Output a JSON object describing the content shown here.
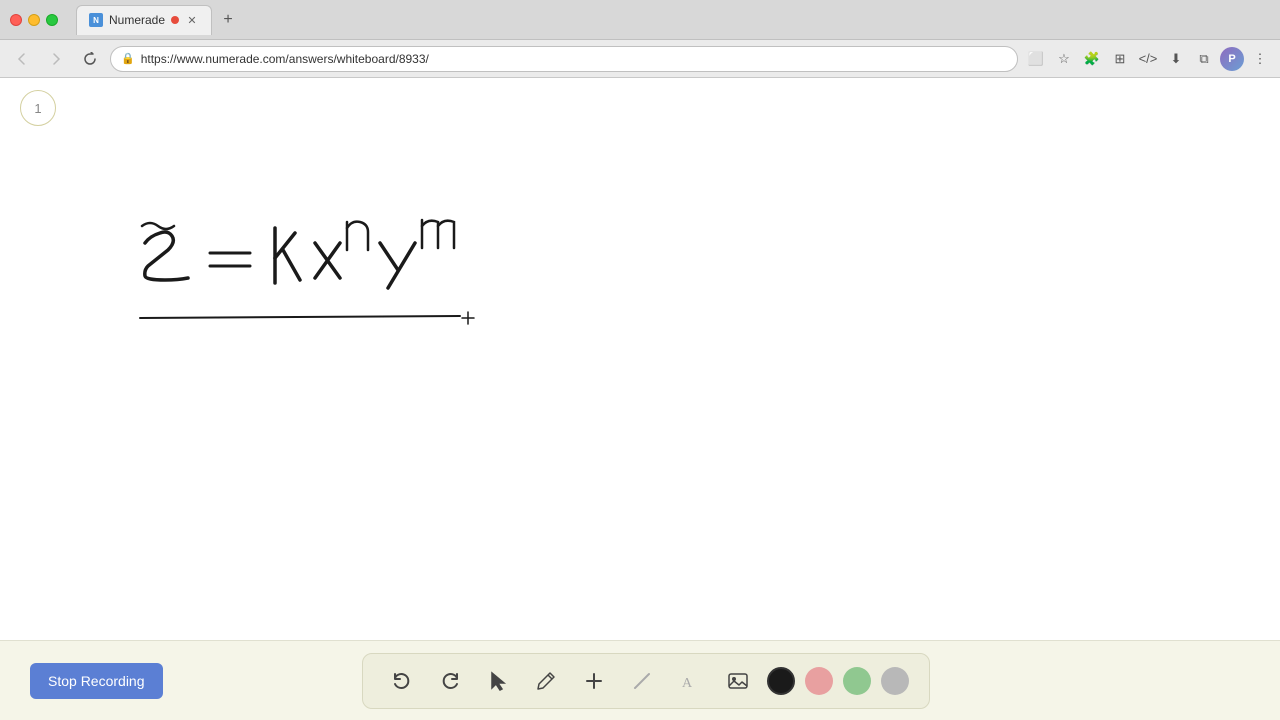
{
  "browser": {
    "tab": {
      "label": "Numerade",
      "favicon_text": "N",
      "has_recording_dot": true
    },
    "url": "https://www.numerade.com/answers/whiteboard/8933/",
    "nav": {
      "back": "←",
      "forward": "→",
      "refresh": "↻"
    }
  },
  "whiteboard": {
    "page_number": "1"
  },
  "toolbar": {
    "stop_recording_label": "Stop Recording",
    "tools": [
      {
        "name": "undo",
        "icon": "↺"
      },
      {
        "name": "redo",
        "icon": "↻"
      },
      {
        "name": "select",
        "icon": "▲"
      },
      {
        "name": "pen",
        "icon": "✏"
      },
      {
        "name": "add",
        "icon": "+"
      },
      {
        "name": "eraser",
        "icon": "◇"
      },
      {
        "name": "text",
        "icon": "A"
      },
      {
        "name": "image",
        "icon": "🖼"
      }
    ],
    "colors": [
      {
        "name": "black",
        "hex": "#1a1a1a"
      },
      {
        "name": "pink",
        "hex": "#e8a0a0"
      },
      {
        "name": "green",
        "hex": "#90c890"
      },
      {
        "name": "gray",
        "hex": "#b8b8b8"
      }
    ],
    "active_color": "black"
  }
}
